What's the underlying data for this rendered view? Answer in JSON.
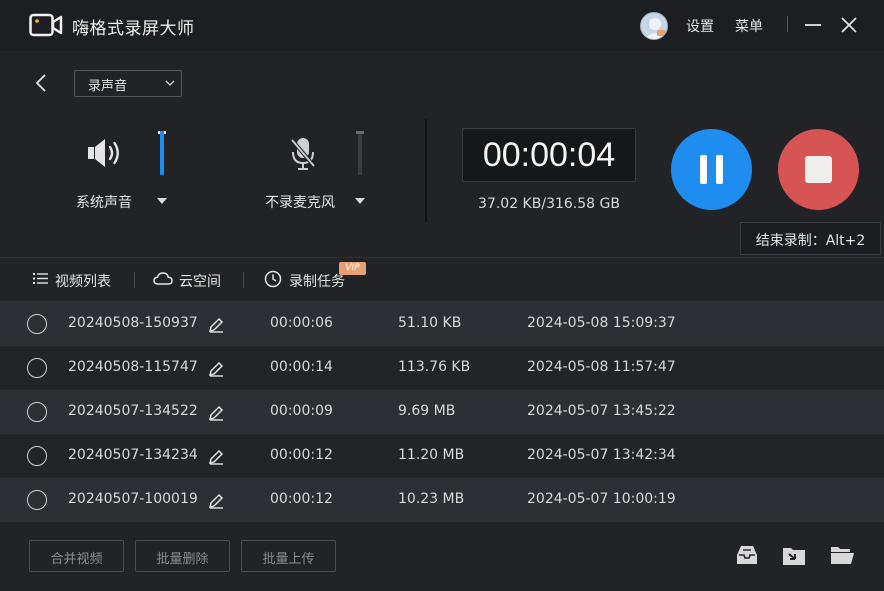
{
  "app": {
    "title": "嗨格式录屏大师"
  },
  "titlebar": {
    "settings_label": "设置",
    "menu_label": "菜单"
  },
  "record": {
    "mode_value": "录声音",
    "system_audio_label": "系统声音",
    "system_audio_level": 1.0,
    "mic_label": "不录麦克风",
    "mic_level": 0.0,
    "timer": "00:00:04",
    "file_size": "37.02 KB/316.58 GB",
    "stop_tooltip": "结束录制：Alt+2"
  },
  "tabs": [
    {
      "label": "视频列表"
    },
    {
      "label": "云空间"
    },
    {
      "label": "录制任务",
      "badge": "VIP"
    }
  ],
  "recordings": [
    {
      "name": "20240508-150937",
      "duration": "00:00:06",
      "size": "51.10 KB",
      "date": "2024-05-08 15:09:37"
    },
    {
      "name": "20240508-115747",
      "duration": "00:00:14",
      "size": "113.76 KB",
      "date": "2024-05-08 11:57:47"
    },
    {
      "name": "20240507-134522",
      "duration": "00:00:09",
      "size": "9.69 MB",
      "date": "2024-05-07 13:45:22"
    },
    {
      "name": "20240507-134234",
      "duration": "00:00:12",
      "size": "11.20 MB",
      "date": "2024-05-07 13:42:34"
    },
    {
      "name": "20240507-100019",
      "duration": "00:00:12",
      "size": "10.23 MB",
      "date": "2024-05-07 10:00:19"
    }
  ],
  "footer": {
    "merge_label": "合并视频",
    "batch_delete_label": "批量删除",
    "batch_upload_label": "批量上传"
  },
  "colors": {
    "accent_blue": "#1f8cf0",
    "stop_red": "#d65454",
    "vip_orange": "#e8a072",
    "background": "#222327",
    "titlebar": "#1d1e22"
  },
  "icons": {
    "app_logo": "video-camera-icon",
    "minimize": "minimize-icon",
    "close": "close-icon",
    "back": "chevron-left-icon",
    "speaker": "speaker-icon",
    "mic_off": "mic-off-icon",
    "video_list": "list-icon",
    "cloud": "cloud-icon",
    "task": "clock-icon",
    "edit": "edit-pen-icon",
    "inbox": "inbox-icon",
    "import": "import-icon",
    "folder": "folder-open-icon"
  }
}
